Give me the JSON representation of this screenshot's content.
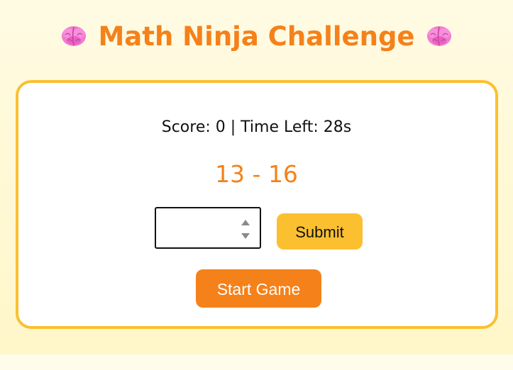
{
  "header": {
    "title": "Math Ninja Challenge",
    "left_icon": "brain-icon",
    "right_icon": "brain-icon"
  },
  "status": {
    "score_label": "Score: 0 | Time Left: 28s"
  },
  "problem": {
    "text": "13 - 16"
  },
  "answer": {
    "value": "",
    "placeholder": ""
  },
  "buttons": {
    "submit_label": "Submit",
    "start_label": "Start Game"
  },
  "colors": {
    "accent_orange": "#f5811a",
    "accent_yellow": "#fbc030",
    "background": "#fff8d6"
  }
}
